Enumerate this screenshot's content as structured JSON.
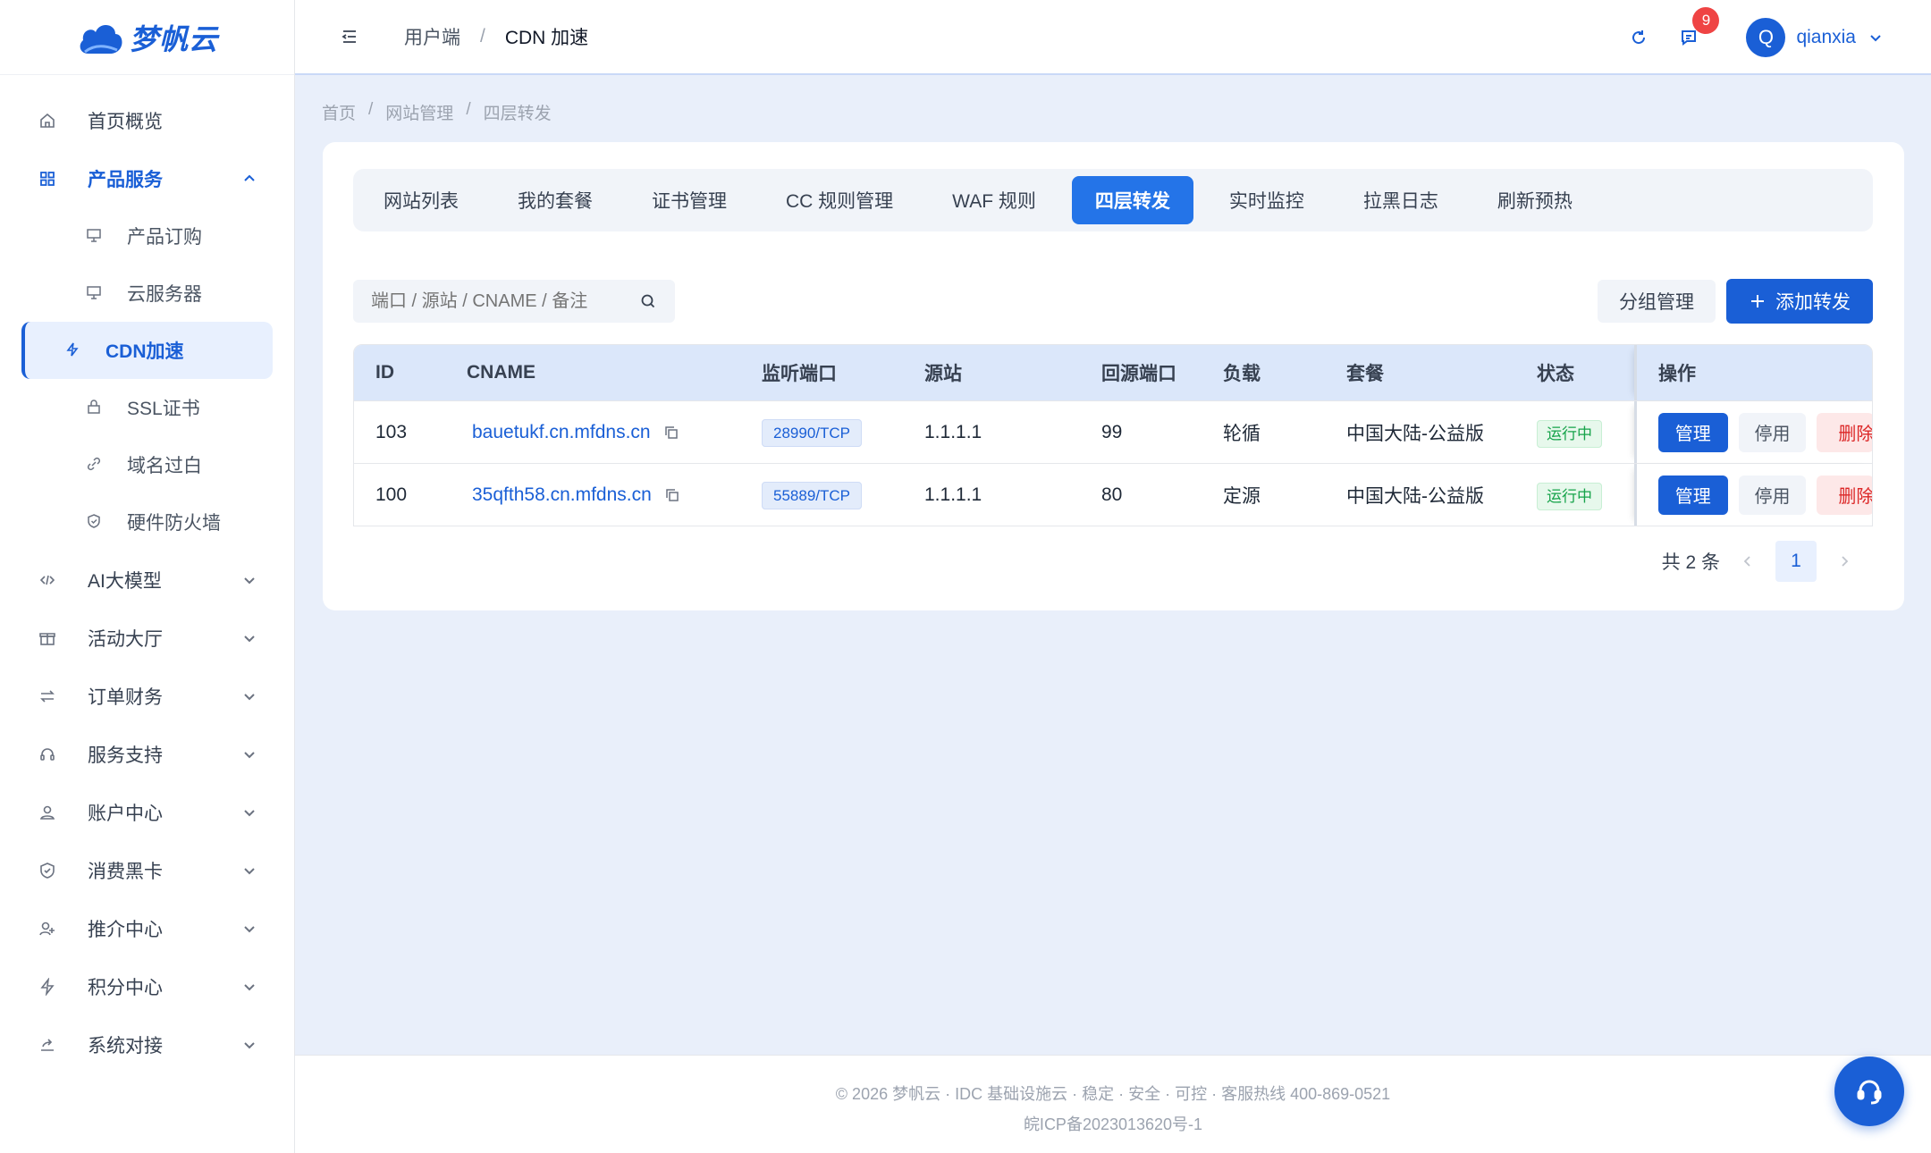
{
  "brand": {
    "logo_text": "梦帆云"
  },
  "sidebar": {
    "items": [
      {
        "label": "首页概览",
        "icon": "home-icon"
      },
      {
        "label": "产品服务",
        "icon": "grid-icon",
        "expanded": true,
        "children": [
          {
            "label": "产品订购",
            "icon": "monitor-icon"
          },
          {
            "label": "云服务器",
            "icon": "monitor-icon"
          },
          {
            "label": "CDN加速",
            "icon": "bolt-icon",
            "active": true
          },
          {
            "label": "SSL证书",
            "icon": "lock-icon"
          },
          {
            "label": "域名过白",
            "icon": "link-icon"
          },
          {
            "label": "硬件防火墙",
            "icon": "shield-icon"
          }
        ]
      },
      {
        "label": "AI大模型",
        "icon": "code-icon"
      },
      {
        "label": "活动大厅",
        "icon": "gift-icon"
      },
      {
        "label": "订单财务",
        "icon": "swap-icon"
      },
      {
        "label": "服务支持",
        "icon": "headset-icon"
      },
      {
        "label": "账户中心",
        "icon": "user-icon"
      },
      {
        "label": "消费黑卡",
        "icon": "shield-check-icon"
      },
      {
        "label": "推介中心",
        "icon": "user-plus-icon"
      },
      {
        "label": "积分中心",
        "icon": "bolt-icon"
      },
      {
        "label": "系统对接",
        "icon": "share-icon"
      }
    ]
  },
  "header": {
    "crumb": [
      "用户端",
      "CDN 加速"
    ],
    "notifications": "9",
    "avatar_letter": "Q",
    "username": "qianxia"
  },
  "page_crumb": [
    "首页",
    "网站管理",
    "四层转发"
  ],
  "tabs": [
    "网站列表",
    "我的套餐",
    "证书管理",
    "CC 规则管理",
    "WAF 规则",
    "四层转发",
    "实时监控",
    "拉黑日志",
    "刷新预热"
  ],
  "active_tab": "四层转发",
  "toolbar": {
    "search_placeholder": "端口 / 源站 / CNAME / 备注",
    "group_btn": "分组管理",
    "add_btn": "添加转发"
  },
  "table": {
    "headers": [
      "ID",
      "CNAME",
      "监听端口",
      "源站",
      "回源端口",
      "负载",
      "套餐",
      "状态",
      "操作"
    ],
    "rows": [
      {
        "id": "103",
        "cname": "bauetukf.cn.mfdns.cn",
        "port": "28990/TCP",
        "source": "1.1.1.1",
        "back_port": "99",
        "lb": "轮循",
        "plan": "中国大陆-公益版",
        "status": "运行中",
        "actions": [
          "管理",
          "停用",
          "删除"
        ]
      },
      {
        "id": "100",
        "cname": "35qfth58.cn.mfdns.cn",
        "port": "55889/TCP",
        "source": "1.1.1.1",
        "back_port": "80",
        "lb": "定源",
        "plan": "中国大陆-公益版",
        "status": "运行中",
        "actions": [
          "管理",
          "停用",
          "删除"
        ]
      }
    ]
  },
  "pager": {
    "total": "共 2 条",
    "current": "1"
  },
  "footer": {
    "line1": "© 2026 梦帆云 · IDC 基础设施云 · 稳定 · 安全 · 可控 · 客服热线 400-869-0521",
    "line2": "皖ICP备2023013620号-1"
  },
  "colors": {
    "primary": "#1a5fd6",
    "tab_active": "#2474e8",
    "success": "#16a34a",
    "danger": "#dc2626",
    "bg": "#e9effa"
  }
}
